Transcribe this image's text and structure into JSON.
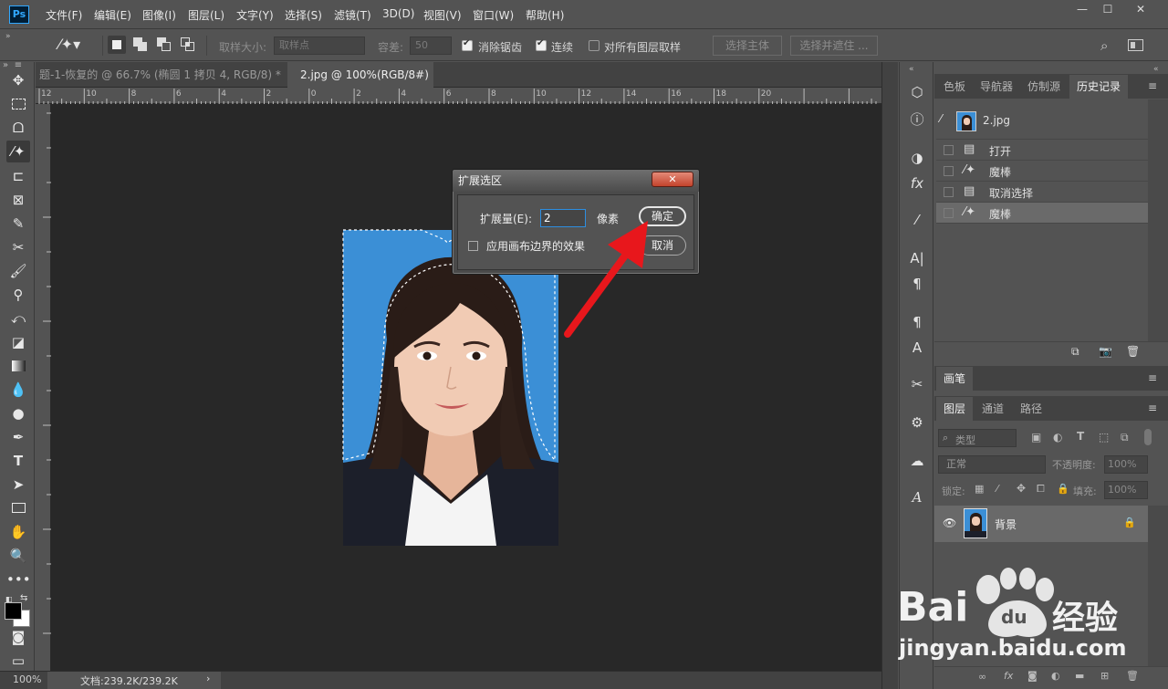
{
  "app": {
    "logo": "Ps"
  },
  "menu": [
    "文件(F)",
    "编辑(E)",
    "图像(I)",
    "图层(L)",
    "文字(Y)",
    "选择(S)",
    "滤镜(T)",
    "3D(D)",
    "视图(V)",
    "窗口(W)",
    "帮助(H)"
  ],
  "window_controls": {
    "minimize": "—",
    "maximize": "☐",
    "close": "✕"
  },
  "options": {
    "sample_size_label": "取样大小:",
    "sample_size_value": "取样点",
    "tolerance_label": "容差:",
    "tolerance_value": "50",
    "anti_alias": "消除锯齿",
    "contiguous": "连续",
    "sample_all_layers": "对所有图层取样",
    "select_subject": "选择主体",
    "select_and_mask": "选择并遮住 ..."
  },
  "tabs": [
    {
      "label": "题-1-恢复的 @ 66.7% (椭圆 1 拷贝 4, RGB/8) *",
      "close": "✕"
    },
    {
      "label": "2.jpg @ 100%(RGB/8#)",
      "close": "✕"
    }
  ],
  "ruler": {
    "top_numbers": [
      "12",
      "10",
      "8",
      "6",
      "4",
      "2",
      "0",
      "2",
      "4",
      "6",
      "8",
      "10",
      "12",
      "14",
      "16",
      "18",
      "20"
    ]
  },
  "statusbar": {
    "zoom": "100%",
    "doc": "文档:239.2K/239.2K",
    "arrow": "›"
  },
  "dialog": {
    "title": "扩展选区",
    "close": "✕",
    "expand_label": "扩展量(E):",
    "expand_value": "2",
    "unit": "像素",
    "apply_canvas": "应用画布边界的效果",
    "ok": "确定",
    "cancel": "取消"
  },
  "panel_top": {
    "tabs": [
      "色板",
      "导航器",
      "仿制源",
      "历史记录"
    ],
    "snapshot": "2.jpg",
    "history": [
      {
        "label": "打开",
        "icon": "document-icon"
      },
      {
        "label": "魔棒",
        "icon": "magic-wand-icon"
      },
      {
        "label": "取消选择",
        "icon": "document-icon"
      },
      {
        "label": "魔棒",
        "icon": "magic-wand-icon"
      }
    ]
  },
  "panel_brush": {
    "tab": "画笔"
  },
  "panel_layers": {
    "tabs": [
      "图层",
      "通道",
      "路径"
    ],
    "filter_label": "类型",
    "blend_mode": "正常",
    "opacity_label": "不透明度:",
    "opacity_value": "100%",
    "lock_label": "锁定:",
    "fill_label": "填充:",
    "fill_value": "100%",
    "layer_name": "背景"
  },
  "watermark": {
    "brand": "Bai",
    "brand2": "du",
    "cn": "经验",
    "url": "jingyan.baidu.com"
  },
  "colors": {
    "accent": "#31a8ff",
    "arrow": "#e8171c",
    "photo_bg": "#3b8fd6"
  }
}
